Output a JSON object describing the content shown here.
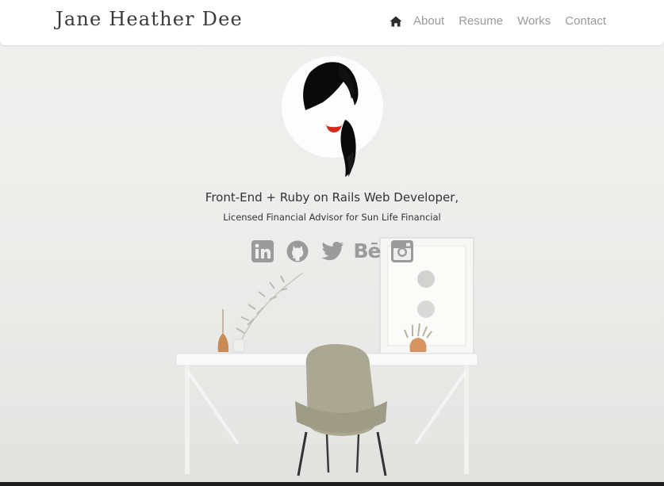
{
  "navbar": {
    "brand": "Jane Heather Dee",
    "home_icon": "home-icon",
    "links": [
      "About",
      "Resume",
      "Works",
      "Contact"
    ]
  },
  "hero": {
    "headline": "Front-End + Ruby on Rails Web Developer,",
    "subline": "Licensed Financial Advisor for Sun Life Financial",
    "social_icons": [
      "linkedin-icon",
      "github-icon",
      "twitter-icon",
      "behance-icon",
      "instagram-icon"
    ],
    "behance_glyph": "Bē"
  },
  "colors": {
    "nav_link": "#9a9a9a",
    "icon": "#9b9b9b",
    "lips": "#d42a1f",
    "hair": "#0a0a0a"
  }
}
